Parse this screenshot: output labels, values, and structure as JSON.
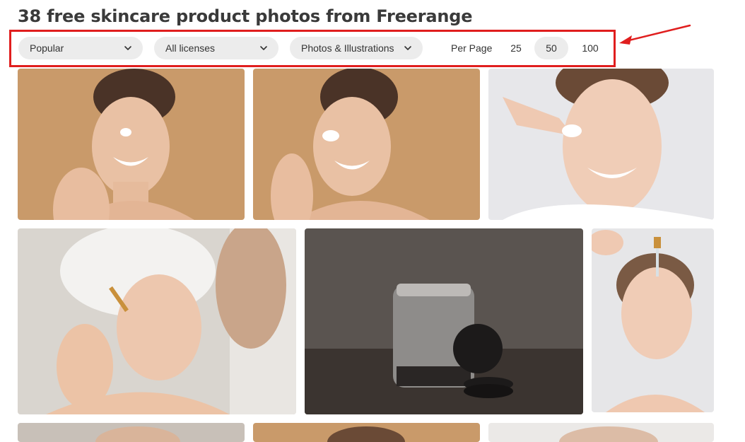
{
  "page": {
    "title": "38 free skincare product photos from Freerange"
  },
  "filters": {
    "sort": {
      "selected": "Popular",
      "icon": "chevron-down-icon"
    },
    "license": {
      "selected": "All licenses",
      "icon": "chevron-down-icon"
    },
    "type": {
      "selected": "Photos & Illustrations",
      "icon": "chevron-down-icon"
    },
    "per_page": {
      "label": "Per Page",
      "options": [
        "25",
        "50",
        "100"
      ],
      "selected": "50"
    }
  },
  "annotation": {
    "highlight_color": "#e01e1e"
  },
  "colors": {
    "pill_background": "#ececec",
    "title": "#3a3a3a"
  }
}
